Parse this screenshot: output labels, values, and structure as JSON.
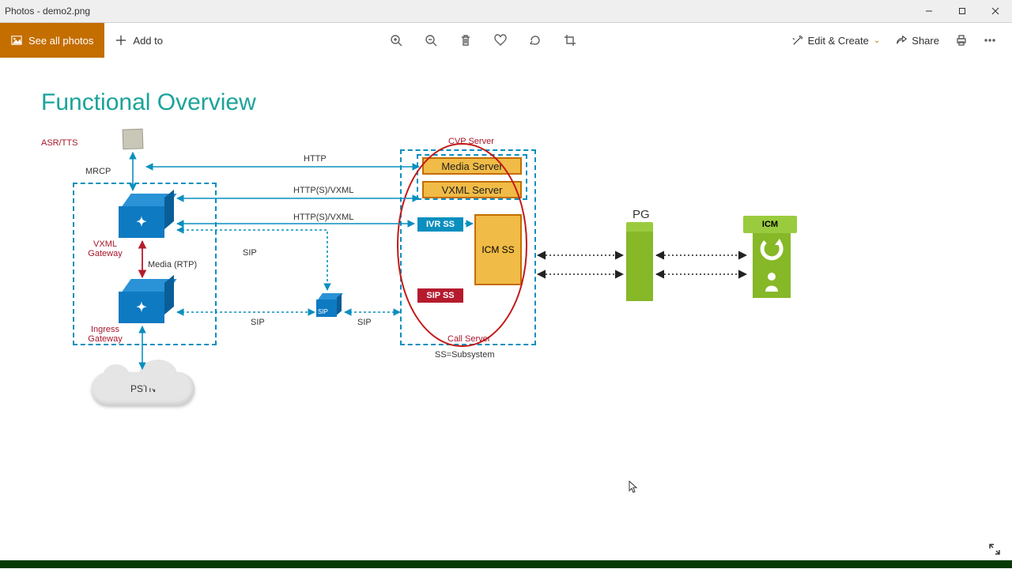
{
  "window": {
    "title": "Photos - demo2.png"
  },
  "toolbar": {
    "see_all": "See all photos",
    "add_to": "Add to",
    "edit_create": "Edit & Create",
    "share": "Share"
  },
  "diagram": {
    "title": "Functional Overview",
    "asr_tts": "ASR/TTS",
    "mrcp": "MRCP",
    "vxml_gateway": "VXML\nGateway",
    "ingress_gateway": "Ingress\nGateway",
    "pstn": "PSTN",
    "media_rtp": "Media (RTP)",
    "sip1": "SIP",
    "sip2": "SIP",
    "sip3": "SIP",
    "http": "HTTP",
    "https_vxml1": "HTTP(S)/VXML",
    "https_vxml2": "HTTP(S)/VXML",
    "cvp_server": "CVP Server",
    "media_server": "Media Server",
    "vxml_server": "VXML Server",
    "ivr_ss": "IVR SS",
    "sip_ss": "SIP SS",
    "icm_ss": "ICM SS",
    "call_server": "Call Server",
    "ss_def": "SS=Subsystem",
    "pg": "PG",
    "icm": "ICM"
  }
}
